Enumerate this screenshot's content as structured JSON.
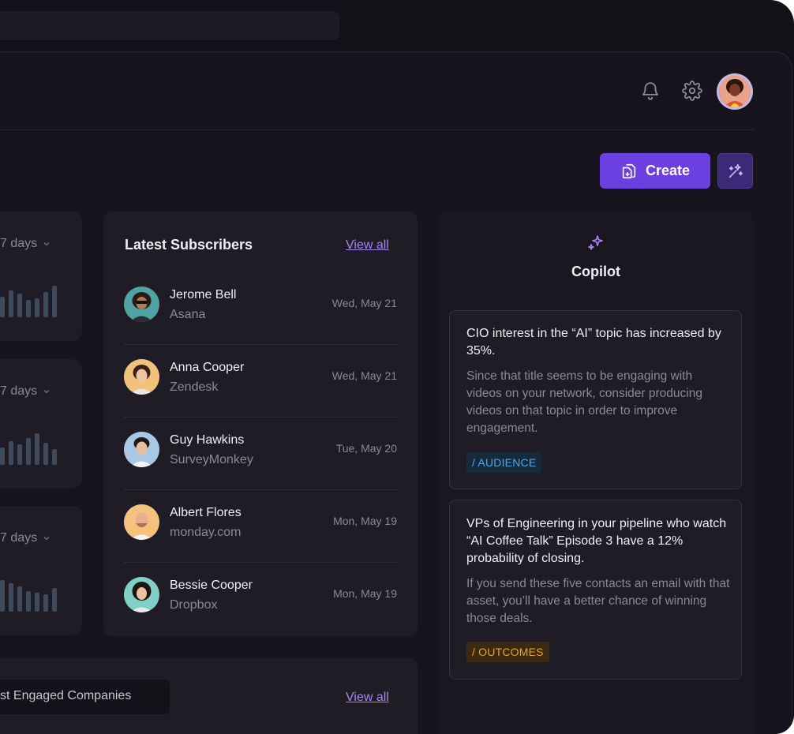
{
  "header": {
    "icons": [
      "bell-icon",
      "gear-icon"
    ],
    "create_label": "Create"
  },
  "mini_cards": [
    {
      "range_label": "7 days"
    },
    {
      "range_label": "7 days"
    },
    {
      "range_label": "7 days"
    }
  ],
  "subscribers": {
    "title": "Latest Subscribers",
    "view_all": "View all",
    "rows": [
      {
        "name": "Jerome Bell",
        "company": "Asana",
        "date": "Wed, May 21"
      },
      {
        "name": "Anna Cooper",
        "company": "Zendesk",
        "date": "Wed, May 21"
      },
      {
        "name": "Guy Hawkins",
        "company": "SurveyMonkey",
        "date": "Tue, May 20"
      },
      {
        "name": "Albert Flores",
        "company": "monday.com",
        "date": "Mon, May 19"
      },
      {
        "name": "Bessie Cooper",
        "company": "Dropbox",
        "date": "Mon, May 19"
      }
    ]
  },
  "companies": {
    "title": "st Engaged Companies",
    "view_all": "View all"
  },
  "copilot": {
    "title": "Copilot",
    "insights": [
      {
        "title": "CIO interest in the “AI” topic has increased by 35%.",
        "body": "Since that title seems to be engaging with videos on your network, consider producing videos on that topic in order to improve engagement.",
        "tag": "/ AUDIENCE",
        "tag_color": "#4aa8f0"
      },
      {
        "title": "VPs of Engineering in your pipeline who watch “AI Coffee Talk” Episode 3 have a 12% probability of closing.",
        "body": "If you send these five contacts an email with that asset, you’ll have a better chance of winning those deals.",
        "tag": "/ OUTCOMES",
        "tag_color": "#f0a020"
      }
    ]
  },
  "colors": {
    "accent": "#6c3fe0",
    "link": "#a884f5",
    "background": "#17141d",
    "card": "#1f1c26"
  }
}
